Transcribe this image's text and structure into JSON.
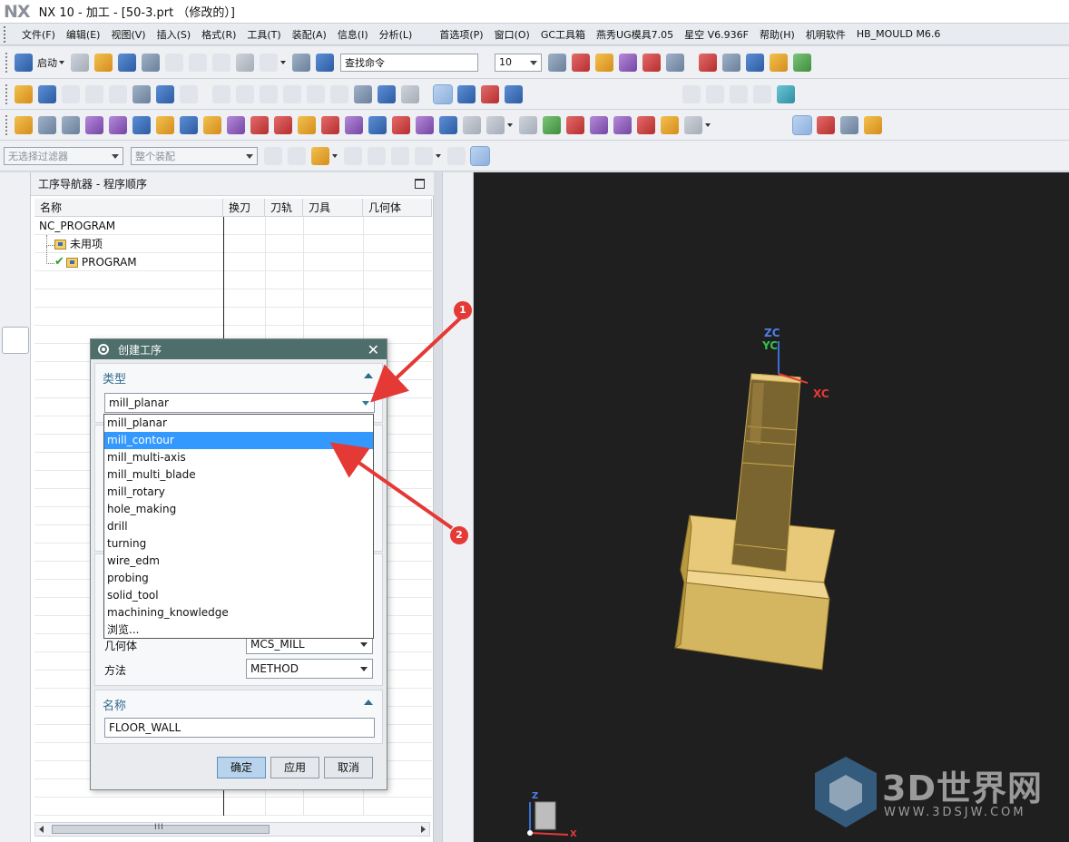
{
  "window": {
    "logo": "NX",
    "title": "NX 10 - 加工 - [50-3.prt （修改的）]"
  },
  "menu": {
    "items": [
      "文件(F)",
      "编辑(E)",
      "视图(V)",
      "插入(S)",
      "格式(R)",
      "工具(T)",
      "装配(A)",
      "信息(I)",
      "分析(L)"
    ],
    "extra_items": [
      "首选项(P)",
      "窗口(O)",
      "GC工具箱",
      "燕秀UG模具7.05",
      "星空 V6.936F",
      "帮助(H)",
      "机明软件",
      "HB_MOULD M6.6"
    ]
  },
  "toolbar": {
    "start_label": "启动",
    "search_command": "查找命令",
    "layer_value": "10",
    "selection_filter": "无选择过滤器",
    "assembly_scope": "整个装配"
  },
  "navigator": {
    "title": "工序导航器 - 程序顺序",
    "columns": [
      "名称",
      "换刀",
      "刀轨",
      "刀具",
      "几何体"
    ],
    "tree": {
      "root": "NC_PROGRAM",
      "unused": "未用项",
      "program": "PROGRAM"
    }
  },
  "dialog": {
    "title": "创建工序",
    "type_section": "类型",
    "type_value": "mill_planar",
    "type_options": [
      "mill_planar",
      "mill_contour",
      "mill_multi-axis",
      "mill_multi_blade",
      "mill_rotary",
      "hole_making",
      "drill",
      "turning",
      "wire_edm",
      "probing",
      "solid_tool",
      "machining_knowledge",
      "浏览..."
    ],
    "selected_option_index": 1,
    "geometry_label": "几何体",
    "geometry_value": "MCS_MILL",
    "method_label": "方法",
    "method_value": "METHOD",
    "name_section": "名称",
    "name_value": "FLOOR_WALL",
    "ok_label": "确定",
    "apply_label": "应用",
    "cancel_label": "取消"
  },
  "viewport": {
    "axis_zc": "ZC",
    "axis_yc": "YC",
    "axis_xc": "XC",
    "triad_z": "Z",
    "triad_x": "X",
    "part_color": "#c9a94f",
    "background": "#1f1f1f"
  },
  "annotations": {
    "callout_1": "1",
    "callout_2": "2",
    "arrow_color": "#e53935"
  },
  "watermark": {
    "text": "3D世界网",
    "url": "WWW.3DSJW.COM"
  }
}
